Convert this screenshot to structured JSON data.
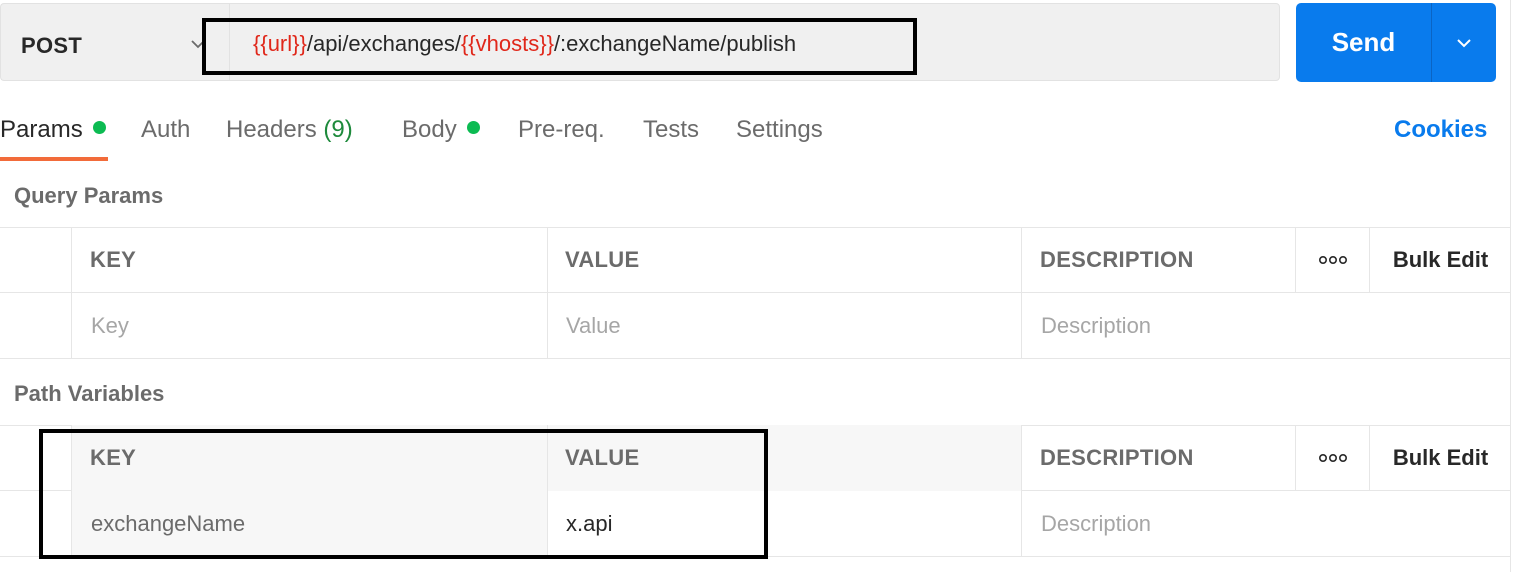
{
  "request": {
    "method": "POST",
    "url_parts": [
      {
        "text": "{{url}}",
        "is_var": true
      },
      {
        "text": "/api/exchanges/",
        "is_var": false
      },
      {
        "text": "{{vhosts}}",
        "is_var": true
      },
      {
        "text": "/:exchangeName/publish",
        "is_var": false
      }
    ],
    "send_label": "Send"
  },
  "tabs": [
    {
      "label": "Params",
      "dot": true,
      "active": true
    },
    {
      "label": "Auth"
    },
    {
      "label": "Headers",
      "count": "(9)"
    },
    {
      "label": "Body",
      "dot": true
    },
    {
      "label": "Pre-req."
    },
    {
      "label": "Tests"
    },
    {
      "label": "Settings"
    }
  ],
  "cookies_label": "Cookies",
  "query_params": {
    "title": "Query Params",
    "headers": {
      "key": "KEY",
      "value": "VALUE",
      "description": "DESCRIPTION",
      "more": "ooo",
      "bulk_edit": "Bulk Edit"
    },
    "placeholders": {
      "key": "Key",
      "value": "Value",
      "description": "Description"
    }
  },
  "path_variables": {
    "title": "Path Variables",
    "headers": {
      "key": "KEY",
      "value": "VALUE",
      "description": "DESCRIPTION",
      "more": "ooo",
      "bulk_edit": "Bulk Edit"
    },
    "rows": [
      {
        "key": "exchangeName",
        "value": "x.api",
        "description_placeholder": "Description"
      }
    ]
  },
  "colors": {
    "accent": "#097bed",
    "variable": "#e0271a",
    "active_tab_underline": "#f26b3a",
    "status_dot": "#0cbb52"
  },
  "icons": {
    "method_dropdown": "chevron-down-icon",
    "send_dropdown": "chevron-down-icon",
    "more": "more-options-icon"
  }
}
